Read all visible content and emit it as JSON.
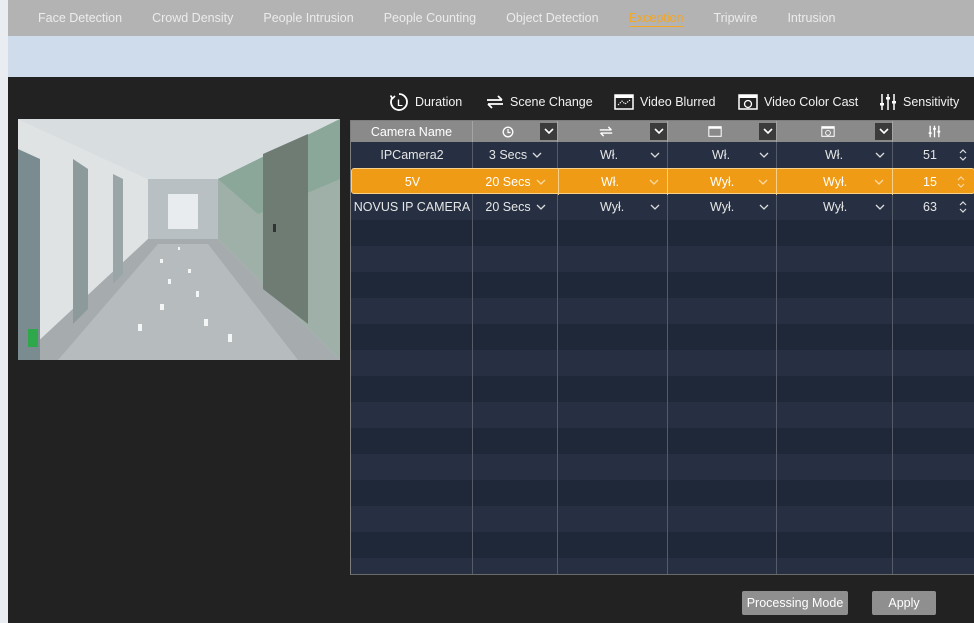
{
  "tabs": [
    {
      "label": "Face Detection",
      "active": false
    },
    {
      "label": "Crowd Density",
      "active": false
    },
    {
      "label": "People Intrusion",
      "active": false
    },
    {
      "label": "People Counting",
      "active": false
    },
    {
      "label": "Object Detection",
      "active": false
    },
    {
      "label": "Exception",
      "active": true
    },
    {
      "label": "Tripwire",
      "active": false
    },
    {
      "label": "Intrusion",
      "active": false
    }
  ],
  "header": {
    "duration": "Duration",
    "scene_change": "Scene Change",
    "video_blurred": "Video Blurred",
    "video_color_cast": "Video Color Cast",
    "sensitivity": "Sensitivity"
  },
  "table": {
    "camera_name_header": "Camera Name",
    "rows": [
      {
        "name": "IPCamera2",
        "duration": "3 Secs",
        "scene_change": "Wł.",
        "video_blurred": "Wł.",
        "color_cast": "Wł.",
        "sensitivity": "51",
        "selected": false
      },
      {
        "name": "5V",
        "duration": "20 Secs",
        "scene_change": "Wł.",
        "video_blurred": "Wył.",
        "color_cast": "Wył.",
        "sensitivity": "15",
        "selected": true
      },
      {
        "name": "NOVUS IP CAMERA",
        "duration": "20 Secs",
        "scene_change": "Wył.",
        "video_blurred": "Wył.",
        "color_cast": "Wył.",
        "sensitivity": "63",
        "selected": false
      }
    ]
  },
  "buttons": {
    "processing_mode": "Processing Mode",
    "apply": "Apply"
  },
  "colors": {
    "accent": "#ef9b15",
    "active_tab": "#f5a623"
  }
}
